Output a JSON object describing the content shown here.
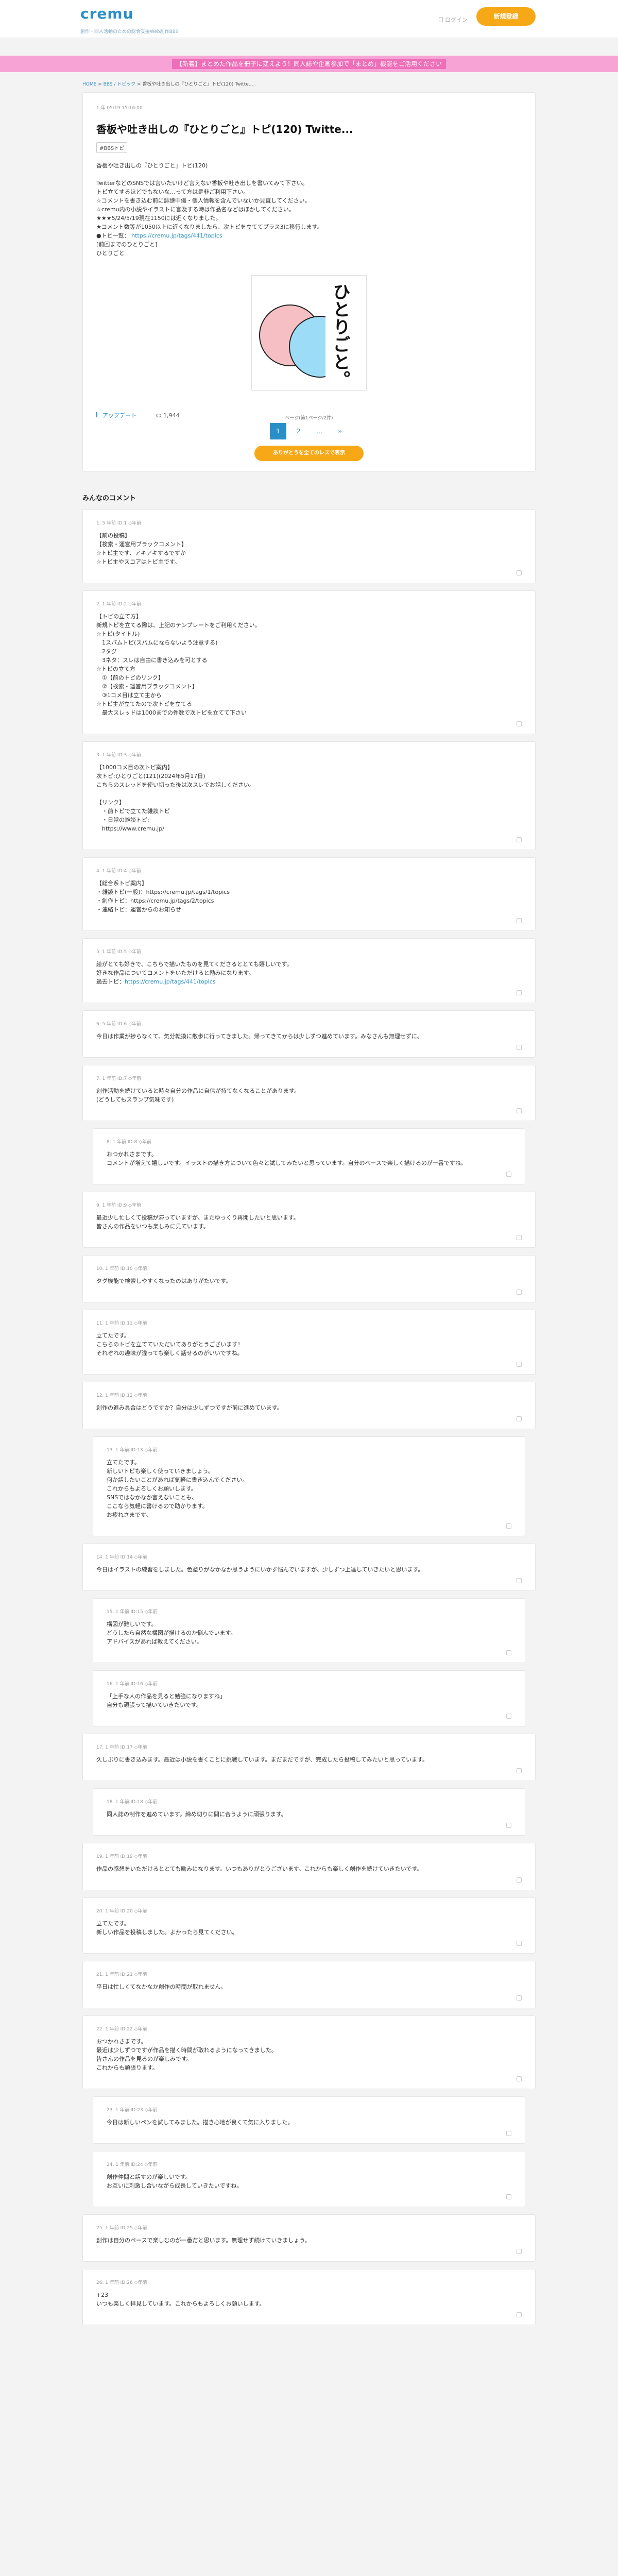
{
  "header": {
    "logo": "cremu",
    "tagline": "創作・同人活動のための総合支援Web創作BBS",
    "login": "ログイン",
    "signup": "新規登録"
  },
  "banner": "【新着】まとめた作品を冊子に変えよう！同人誌や企画参加で「まとめ」機能をご活用ください",
  "breadcrumb": {
    "home": "HOME",
    "category": "BBS / トピック",
    "current": "香板や吐き出しの『ひとりごと』トピ(120) Twitte..."
  },
  "post": {
    "date": "1 年 05/19 15:16:00",
    "title": "香板や吐き出しの『ひとりごと』トピ(120) Twitte...",
    "tag": "#BBSトピ",
    "description": "香板や吐き出しの『ひとりごと』トピ(120)\n\nTwitterなどのSNSでは言いたいけど言えない香板や吐き出しを書いてみて下さい。\nトピ立てするほどでもないな…って方は是非ご利用下さい。\n☆コメントを書き込む前に誹謗中傷・個人情報を含んでいないか見直してください。\n☆cremu内の小説やイラストに言及する時は作品名などはぼかしてください。\n★★★5/24/5/19現在1150には近くなりました。\n★コメント数等が1050以上に近くなりましたら、次トピを立ててプラス3に移行します。\n●トピ一覧：",
    "link1": "https://cremu.jp/tags/441/topics",
    "description_tail": "[前回までのひとりごと]\nひとりごと",
    "image_text": "ひとりごと。",
    "likes_label": "アップデート",
    "views": "1,944",
    "pager_label": "ページ(第1ページ/2件)",
    "pages": [
      "1",
      "2",
      "…",
      "»"
    ],
    "read_button": "ありがとうを全てのレスで表示"
  },
  "comments_title": "みんなのコメント",
  "comments": [
    {
      "meta": "1. 5 年前 ID:1 ◇年前",
      "body": "【前の投稿】\n【検索・運営用ブラックコメント】\n☆トピ主です、アキアキするですか\n☆トピ主やスコアはトピ主です。"
    },
    {
      "meta": "2. 1 年前 ID:2 ◇年前",
      "body": "【トピの立て方】\n新規トピを立てる際は、上記のテンプレートをご利用ください。\n☆トピ(タイトル)\n　1スパムトピ(スパムにならないよう注意する)\n　2タグ\n　3ネタ：スレは自由に書き込みを可とする\n☆トピの立て方\n　①【前のトピのリンク】\n　②【検索・運営用ブラックコメント】\n　③1コメ目は立て主から\n☆トピ主が立てたので次トピを立てる\n　最大スレッドは1000までの件数で次トピを立てて下さい"
    },
    {
      "meta": "3. 1 年前 ID:3 ◇年前",
      "body": "【1000コメ目の次トピ案内】\n次トピ:ひとりごと(121)(2024年5月17日)\nこちらのスレッドを使い切った後は次スレでお話しください。\n\n【リンク】\n　・前トピで立てた雑談トピ\n　・日常の雑談トピ:\n　https://www.cremu.jp/"
    },
    {
      "meta": "4. 1 年前 ID:4 ◇年前",
      "body": "【総合系トピ案内】\n・雑談トピ(一般)：https://cremu.jp/tags/1/topics\n・創作トピ：https://cremu.jp/tags/2/topics\n・連絡トピ：運営からのお知らせ"
    },
    {
      "meta": "5. 1 年前 ID:5 ◇年前",
      "body": "絵がとても好きで、こちらで描いたものを見てくださるととても嬉しいです。\n好きな作品についてコメントをいただけると励みになります。\n過去トピ：",
      "link": "https://cremu.jp/tags/441/topics",
      "indent": false
    },
    {
      "meta": "6. 5 年前 ID:6 ◇年前",
      "body": "今日は作業が捗らなくて、気分転換に散歩に行ってきました。帰ってきてからは少しずつ進めています。みなさんも無理せずに。"
    },
    {
      "meta": "7. 1 年前 ID:7 ◇年前",
      "body": "創作活動を続けていると時々自分の作品に自信が持てなくなることがあります。\n(どうしてもスランプ気味です)"
    },
    {
      "meta": "8. 1 年前 ID:8 ◇年前",
      "body": "おつかれさまです。\nコメントが増えて嬉しいです。イラストの描き方について色々と試してみたいと思っています。自分のペースで楽しく描けるのが一番ですね。",
      "indent": true
    },
    {
      "meta": "9. 1 年前 ID:9 ◇年前",
      "body": "最近少し忙しくて投稿が滞っていますが、またゆっくり再開したいと思います。\n皆さんの作品をいつも楽しみに見ています。"
    },
    {
      "meta": "10. 1 年前 ID:10 ◇年前",
      "body": "タグ機能で検索しやすくなったのはありがたいです。"
    },
    {
      "meta": "11. 1 年前 ID:11 ◇年前",
      "body": "立てたです。\nこちらのトピを立てていただいてありがとうございます！\nそれぞれの趣味が違っても楽しく話せるのがいいですね。"
    },
    {
      "meta": "12. 1 年前 ID:12 ◇年前",
      "body": "創作の進み具合はどうですか？自分は少しずつですが前に進めています。"
    },
    {
      "meta": "13. 1 年前 ID:13 ◇年前",
      "body": "立てたです。\n新しいトピも楽しく使っていきましょう。\n何か話したいことがあれば気軽に書き込んでください。\nこれからもよろしくお願いします。\nSNSではなかなか言えないことも、\nここなら気軽に書けるので助かります。\nお疲れさまです。",
      "indent": true
    },
    {
      "meta": "14. 1 年前 ID:14 ◇年前",
      "body": "今日はイラストの練習をしました。色塗りがなかなか思うようにいかず悩んでいますが、少しずつ上達していきたいと思います。"
    },
    {
      "meta": "15. 1 年前 ID:15 ◇年前",
      "body": "構図が難しいです。\nどうしたら自然な構図が描けるのか悩んでいます。\nアドバイスがあれば教えてください。",
      "indent": true
    },
    {
      "meta": "16. 1 年前 ID:16 ◇年前",
      "body": "「上手な人の作品を見ると勉強になりますね」\n自分も頑張って描いていきたいです。",
      "indent": true
    },
    {
      "meta": "17. 1 年前 ID:17 ◇年前",
      "body": "久しぶりに書き込みます。最近は小説を書くことに挑戦しています。まだまだですが、完成したら投稿してみたいと思っています。"
    },
    {
      "meta": "18. 1 年前 ID:18 ◇年前",
      "body": "同人誌の制作を進めています。締め切りに間に合うように頑張ります。",
      "indent": true
    },
    {
      "meta": "19. 1 年前 ID:19 ◇年前",
      "body": "作品の感想をいただけるととても励みになります。いつもありがとうございます。これからも楽しく創作を続けていきたいです。"
    },
    {
      "meta": "20. 1 年前 ID:20 ◇年前",
      "body": "立てたです。\n新しい作品を投稿しました。よかったら見てください。"
    },
    {
      "meta": "21. 1 年前 ID:21 ◇年前",
      "body": "平日は忙しくてなかなか創作の時間が取れません。"
    },
    {
      "meta": "22. 1 年前 ID:22 ◇年前",
      "body": "おつかれさまです。\n最近は少しずつですが作品を描く時間が取れるようになってきました。\n皆さんの作品を見るのが楽しみです。\nこれからも頑張ります。"
    },
    {
      "meta": "23. 1 年前 ID:23 ◇年前",
      "body": "今日は新しいペンを試してみました。描き心地が良くて気に入りました。",
      "indent": true
    },
    {
      "meta": "24. 1 年前 ID:24 ◇年前",
      "body": "創作仲間と話すのが楽しいです。\nお互いに刺激し合いながら成長していきたいですね。",
      "indent": true
    },
    {
      "meta": "25. 1 年前 ID:25 ◇年前",
      "body": "創作は自分のペースで楽しむのが一番だと思います。無理せず続けていきましょう。"
    },
    {
      "meta": "26. 1 年前 ID:26 ◇年前",
      "body": "+23\nいつも楽しく拝見しています。これからもよろしくお願いします。"
    }
  ]
}
